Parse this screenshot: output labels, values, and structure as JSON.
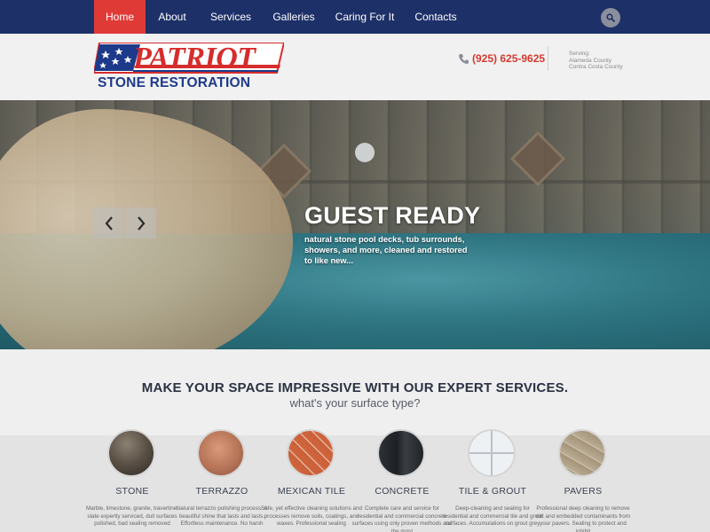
{
  "nav": {
    "items": [
      {
        "label": "Home",
        "active": true
      },
      {
        "label": "About",
        "active": false
      },
      {
        "label": "Services",
        "active": false
      },
      {
        "label": "Galleries",
        "active": false
      },
      {
        "label": "Caring For It",
        "active": false
      },
      {
        "label": "Contacts",
        "active": false
      }
    ],
    "search_icon": "search-icon"
  },
  "header": {
    "logo": {
      "word": "PATRIOT",
      "subtitle": "STONE RESTORATION"
    },
    "phone": "(925) 625-9625",
    "serving": {
      "label": "Serving:",
      "areas": [
        "Alameda County",
        "Contra Costa County"
      ]
    }
  },
  "hero": {
    "title": "GUEST READY",
    "description": "natural stone pool decks, tub surrounds, showers, and more, cleaned and restored to like new...",
    "prev_icon": "chevron-left-icon",
    "next_icon": "chevron-right-icon"
  },
  "services": {
    "heading": "MAKE YOUR SPACE IMPRESSIVE WITH OUR EXPERT SERVICES.",
    "subheading": "what's your surface type?",
    "items": [
      {
        "name": "STONE",
        "description": "Marble, limestone, granite, travertine, slate expertly serviced, dull surfaces polished, bad sealing removed"
      },
      {
        "name": "TERRAZZO",
        "description": "Natural terrazzo polishing process. A beautiful shine that lasts and lasts. Effortless maintenance. No harsh"
      },
      {
        "name": "MEXICAN TILE",
        "description": "Safe, yet effective cleaning solutions and processes remove soils, coatings, and waxes. Professional sealing"
      },
      {
        "name": "CONCRETE",
        "description": "Complete care and service for residential and commercial concrete surfaces using only proven methods and the most"
      },
      {
        "name": "TILE & GROUT",
        "description": "Deep-cleaning and sealing for residential and commercial tile and grout surfaces. Accumulations on grout grey"
      },
      {
        "name": "PAVERS",
        "description": "Professional deep cleaning to remove dirt and embedded contaminants from your pavers. Sealing to protect and inhibit"
      }
    ]
  },
  "colors": {
    "nav_bg": "#1d3068",
    "nav_active": "#e03a36",
    "brand_red": "#d62c2c",
    "brand_blue": "#1d3a8a",
    "phone_red": "#d53a2f"
  }
}
